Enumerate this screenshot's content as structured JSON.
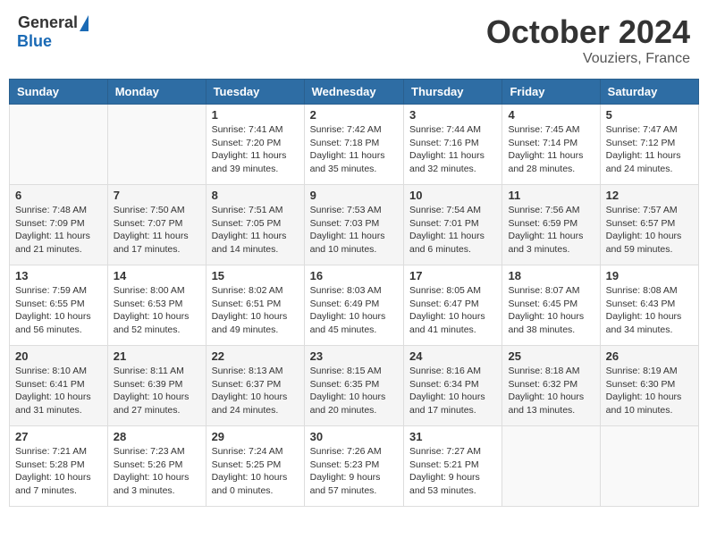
{
  "header": {
    "logo_general": "General",
    "logo_blue": "Blue",
    "month_title": "October 2024",
    "location": "Vouziers, France"
  },
  "weekdays": [
    "Sunday",
    "Monday",
    "Tuesday",
    "Wednesday",
    "Thursday",
    "Friday",
    "Saturday"
  ],
  "weeks": [
    [
      {
        "day": "",
        "info": ""
      },
      {
        "day": "",
        "info": ""
      },
      {
        "day": "1",
        "info": "Sunrise: 7:41 AM\nSunset: 7:20 PM\nDaylight: 11 hours and 39 minutes."
      },
      {
        "day": "2",
        "info": "Sunrise: 7:42 AM\nSunset: 7:18 PM\nDaylight: 11 hours and 35 minutes."
      },
      {
        "day": "3",
        "info": "Sunrise: 7:44 AM\nSunset: 7:16 PM\nDaylight: 11 hours and 32 minutes."
      },
      {
        "day": "4",
        "info": "Sunrise: 7:45 AM\nSunset: 7:14 PM\nDaylight: 11 hours and 28 minutes."
      },
      {
        "day": "5",
        "info": "Sunrise: 7:47 AM\nSunset: 7:12 PM\nDaylight: 11 hours and 24 minutes."
      }
    ],
    [
      {
        "day": "6",
        "info": "Sunrise: 7:48 AM\nSunset: 7:09 PM\nDaylight: 11 hours and 21 minutes."
      },
      {
        "day": "7",
        "info": "Sunrise: 7:50 AM\nSunset: 7:07 PM\nDaylight: 11 hours and 17 minutes."
      },
      {
        "day": "8",
        "info": "Sunrise: 7:51 AM\nSunset: 7:05 PM\nDaylight: 11 hours and 14 minutes."
      },
      {
        "day": "9",
        "info": "Sunrise: 7:53 AM\nSunset: 7:03 PM\nDaylight: 11 hours and 10 minutes."
      },
      {
        "day": "10",
        "info": "Sunrise: 7:54 AM\nSunset: 7:01 PM\nDaylight: 11 hours and 6 minutes."
      },
      {
        "day": "11",
        "info": "Sunrise: 7:56 AM\nSunset: 6:59 PM\nDaylight: 11 hours and 3 minutes."
      },
      {
        "day": "12",
        "info": "Sunrise: 7:57 AM\nSunset: 6:57 PM\nDaylight: 10 hours and 59 minutes."
      }
    ],
    [
      {
        "day": "13",
        "info": "Sunrise: 7:59 AM\nSunset: 6:55 PM\nDaylight: 10 hours and 56 minutes."
      },
      {
        "day": "14",
        "info": "Sunrise: 8:00 AM\nSunset: 6:53 PM\nDaylight: 10 hours and 52 minutes."
      },
      {
        "day": "15",
        "info": "Sunrise: 8:02 AM\nSunset: 6:51 PM\nDaylight: 10 hours and 49 minutes."
      },
      {
        "day": "16",
        "info": "Sunrise: 8:03 AM\nSunset: 6:49 PM\nDaylight: 10 hours and 45 minutes."
      },
      {
        "day": "17",
        "info": "Sunrise: 8:05 AM\nSunset: 6:47 PM\nDaylight: 10 hours and 41 minutes."
      },
      {
        "day": "18",
        "info": "Sunrise: 8:07 AM\nSunset: 6:45 PM\nDaylight: 10 hours and 38 minutes."
      },
      {
        "day": "19",
        "info": "Sunrise: 8:08 AM\nSunset: 6:43 PM\nDaylight: 10 hours and 34 minutes."
      }
    ],
    [
      {
        "day": "20",
        "info": "Sunrise: 8:10 AM\nSunset: 6:41 PM\nDaylight: 10 hours and 31 minutes."
      },
      {
        "day": "21",
        "info": "Sunrise: 8:11 AM\nSunset: 6:39 PM\nDaylight: 10 hours and 27 minutes."
      },
      {
        "day": "22",
        "info": "Sunrise: 8:13 AM\nSunset: 6:37 PM\nDaylight: 10 hours and 24 minutes."
      },
      {
        "day": "23",
        "info": "Sunrise: 8:15 AM\nSunset: 6:35 PM\nDaylight: 10 hours and 20 minutes."
      },
      {
        "day": "24",
        "info": "Sunrise: 8:16 AM\nSunset: 6:34 PM\nDaylight: 10 hours and 17 minutes."
      },
      {
        "day": "25",
        "info": "Sunrise: 8:18 AM\nSunset: 6:32 PM\nDaylight: 10 hours and 13 minutes."
      },
      {
        "day": "26",
        "info": "Sunrise: 8:19 AM\nSunset: 6:30 PM\nDaylight: 10 hours and 10 minutes."
      }
    ],
    [
      {
        "day": "27",
        "info": "Sunrise: 7:21 AM\nSunset: 5:28 PM\nDaylight: 10 hours and 7 minutes."
      },
      {
        "day": "28",
        "info": "Sunrise: 7:23 AM\nSunset: 5:26 PM\nDaylight: 10 hours and 3 minutes."
      },
      {
        "day": "29",
        "info": "Sunrise: 7:24 AM\nSunset: 5:25 PM\nDaylight: 10 hours and 0 minutes."
      },
      {
        "day": "30",
        "info": "Sunrise: 7:26 AM\nSunset: 5:23 PM\nDaylight: 9 hours and 57 minutes."
      },
      {
        "day": "31",
        "info": "Sunrise: 7:27 AM\nSunset: 5:21 PM\nDaylight: 9 hours and 53 minutes."
      },
      {
        "day": "",
        "info": ""
      },
      {
        "day": "",
        "info": ""
      }
    ]
  ]
}
